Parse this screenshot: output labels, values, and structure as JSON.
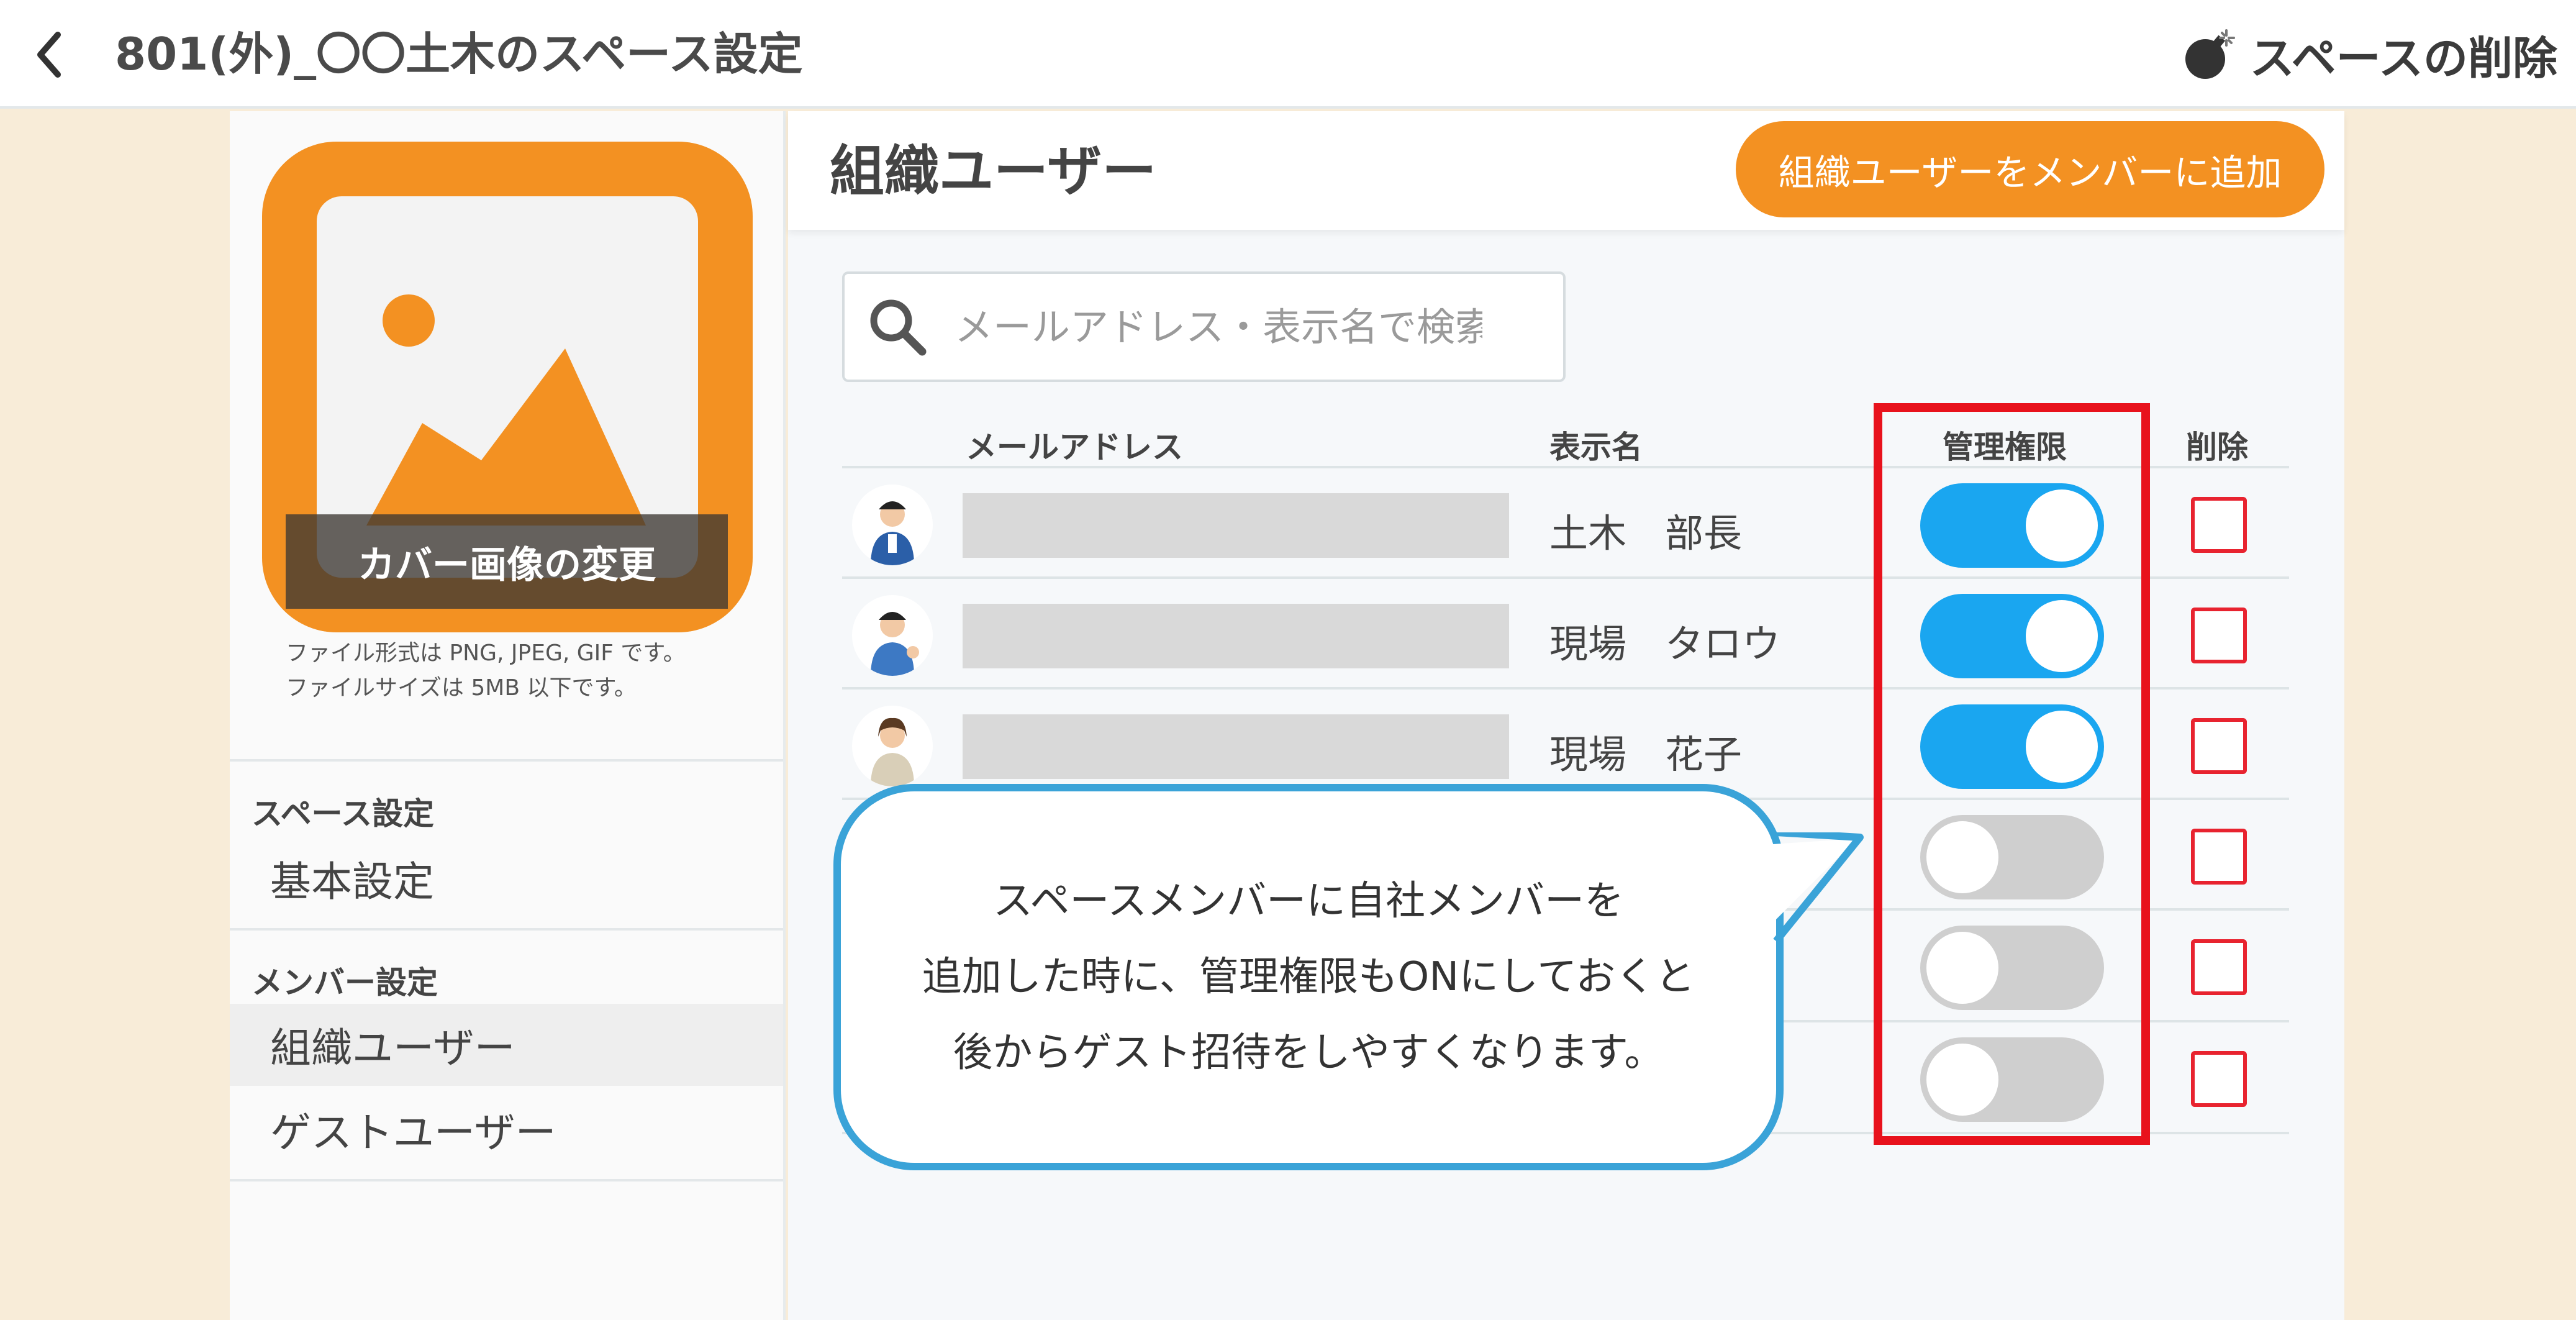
{
  "header": {
    "title": "801(外)_〇〇土木のスペース設定",
    "delete_space_label": "スペースの削除"
  },
  "sidebar": {
    "cover_change_label": "カバー画像の変更",
    "file_format_note": "ファイル形式は PNG, JPEG, GIF です。",
    "file_size_note": "ファイルサイズは 5MB 以下です。",
    "space_settings_title": "スペース設定",
    "basic_settings_label": "基本設定",
    "member_settings_title": "メンバー設定",
    "org_users_label": "組織ユーザー",
    "guest_users_label": "ゲストユーザー",
    "active_item": "組織ユーザー"
  },
  "main": {
    "title": "組織ユーザー",
    "add_button_label": "組織ユーザーをメンバーに追加",
    "search_placeholder": "メールアドレス・表示名で検索",
    "columns": {
      "email": "メールアドレス",
      "display_name": "表示名",
      "admin": "管理権限",
      "delete": "削除"
    },
    "rows": [
      {
        "display_name": "土木　部長",
        "admin": true
      },
      {
        "display_name": "現場　タロウ",
        "admin": true
      },
      {
        "display_name": "現場　花子",
        "admin": true
      },
      {
        "display_name": "",
        "admin": false
      },
      {
        "display_name": "",
        "admin": false
      },
      {
        "display_name": "",
        "admin": false
      }
    ]
  },
  "callout": {
    "line1": "スペースメンバーに自社メンバーを",
    "line2": "追加した時に、管理権限もONにしておくと",
    "line3": "後からゲスト招待をしやすくなります。"
  },
  "colors": {
    "accent_orange": "#f39122",
    "toggle_on": "#1aa6f0",
    "toggle_off": "#cfcfcf",
    "highlight_red": "#e8121c",
    "callout_border": "#3aa3d8",
    "page_bg": "#f8ecd8"
  },
  "icons": [
    "back-chevron-icon",
    "bomb-icon",
    "image-placeholder-icon",
    "search-icon",
    "user-avatar-icon"
  ]
}
